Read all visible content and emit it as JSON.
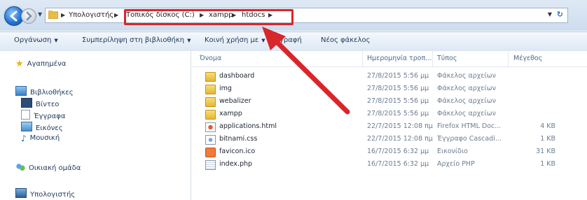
{
  "address_bar": {
    "breadcrumbs": [
      "Υπολογιστής",
      "Τοπικός δίσκος (C:)",
      "xampp",
      "htdocs"
    ]
  },
  "toolbar": {
    "organize": "Οργάνωση",
    "include_library": "Συμπερίληψη στη βιβλιοθήκη",
    "share_with": "Κοινή χρήση με",
    "burn": "Εγγραφή",
    "burn_visible": "γγραφή",
    "new_folder": "Νέος φάκελος"
  },
  "nav": {
    "favorites": "Αγαπημένα",
    "libraries": "Βιβλιοθήκες",
    "videos": "Βίντεο",
    "documents": "Έγγραφα",
    "pictures": "Εικόνες",
    "music": "Μουσική",
    "homegroup": "Οικιακή ομάδα",
    "computer": "Υπολογιστής"
  },
  "columns": {
    "name": "Όνομα",
    "date": "Ημερομηνία τροπ...",
    "type": "Τύπος",
    "size": "Μέγεθος"
  },
  "files": [
    {
      "name": "dashboard",
      "date": "27/8/2015 5:56 μμ",
      "type": "Φάκελος αρχείων",
      "size": "",
      "icon": "folder-icon"
    },
    {
      "name": "img",
      "date": "27/8/2015 5:56 μμ",
      "type": "Φάκελος αρχείων",
      "size": "",
      "icon": "folder-icon"
    },
    {
      "name": "webalizer",
      "date": "27/8/2015 5:56 μμ",
      "type": "Φάκελος αρχείων",
      "size": "",
      "icon": "folder-icon"
    },
    {
      "name": "xampp",
      "date": "27/8/2015 5:56 μμ",
      "type": "Φάκελος αρχείων",
      "size": "",
      "icon": "folder-icon"
    },
    {
      "name": "applications.html",
      "date": "22/7/2015 12:08 πμ",
      "type": "Firefox HTML Doc...",
      "size": "4 KB",
      "icon": "html-file-icon"
    },
    {
      "name": "bitnami.css",
      "date": "22/7/2015 12:08 πμ",
      "type": "Έγγραφο Cascadi...",
      "size": "1 KB",
      "icon": "css-file-icon"
    },
    {
      "name": "favicon.ico",
      "date": "16/7/2015 6:32 μμ",
      "type": "Εικονίδιο",
      "size": "31 KB",
      "icon": "ico-file-icon"
    },
    {
      "name": "index.php",
      "date": "16/7/2015 6:32 μμ",
      "type": "Αρχείο PHP",
      "size": "1 KB",
      "icon": "php-file-icon"
    }
  ],
  "colors": {
    "highlight": "#d8262a",
    "folder": "#e6b532",
    "nav_text": "#1e395b"
  }
}
